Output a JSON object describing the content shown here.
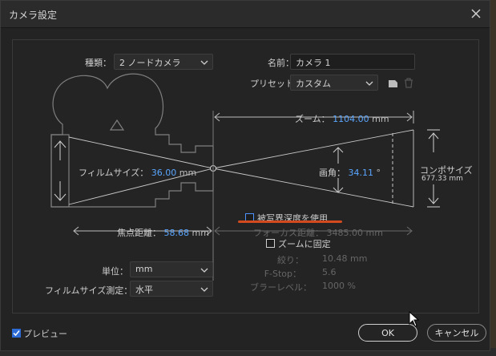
{
  "window": {
    "title": "カメラ設定"
  },
  "fields": {
    "type_label": "種類：",
    "type_value": "2 ノードカメラ",
    "name_label": "名前：",
    "name_value": "カメラ 1",
    "preset_label": "プリセット：",
    "preset_value": "カスタム"
  },
  "diagram": {
    "zoom_label": "ズーム：",
    "zoom_value": "1104.00",
    "zoom_unit": "mm",
    "film_size_label": "フィルムサイズ：",
    "film_size_value": "36.00",
    "film_size_unit": "mm",
    "angle_label": "画角：",
    "angle_value": "34.11",
    "angle_unit": "°",
    "comp_size_label": "コンポサイズ",
    "comp_size_value": "677.33 mm",
    "focal_length_label": "焦点距離：",
    "focal_length_value": "58.68",
    "focal_length_unit": "mm",
    "focus_distance_label": "フォーカス距離：",
    "focus_distance_value": "3485.00 mm"
  },
  "options": {
    "dof_label": "被写界深度を使用",
    "lock_zoom_label": "ズームに固定",
    "aperture_label": "絞り：",
    "aperture_value": "10.48 mm",
    "fstop_label": "F-Stop：",
    "fstop_value": "5.6",
    "blur_label": "ブラーレベル：",
    "blur_value": "1000 %"
  },
  "units": {
    "unit_label": "単位：",
    "unit_value": "mm",
    "measure_label": "フィルムサイズ測定：",
    "measure_value": "水平"
  },
  "footer": {
    "preview_label": "プレビュー",
    "ok_label": "OK",
    "cancel_label": "キャンセル"
  }
}
